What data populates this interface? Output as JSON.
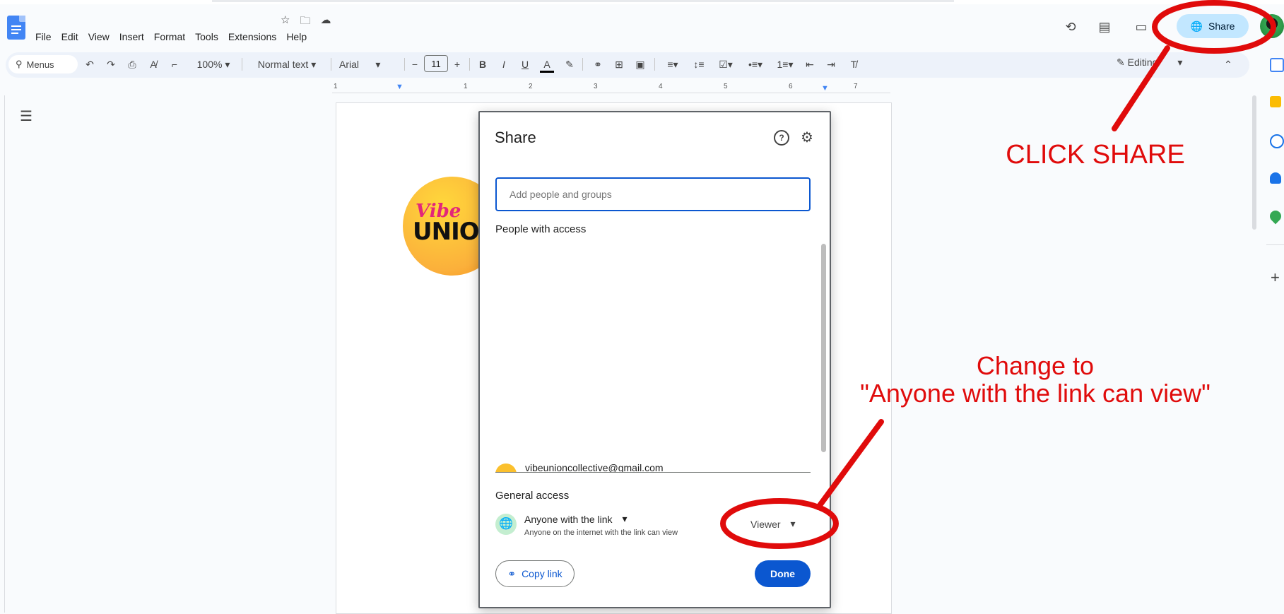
{
  "menu": {
    "items": [
      "File",
      "Edit",
      "View",
      "Insert",
      "Format",
      "Tools",
      "Extensions",
      "Help"
    ]
  },
  "header": {
    "share_label": "Share"
  },
  "toolbar": {
    "search_label": "Menus",
    "zoom": "100%",
    "style": "Normal text",
    "font": "Arial",
    "font_size": "11",
    "bold": "B",
    "italic": "I",
    "underline": "U",
    "text_color": "A",
    "editing_label": "Editing"
  },
  "ruler": {
    "labels": [
      "1",
      "1",
      "2",
      "3",
      "4",
      "5",
      "6",
      "7"
    ]
  },
  "document": {
    "logo_top": "Vibe",
    "logo_bottom": "UNIO"
  },
  "dialog": {
    "title": "Share",
    "help_icon_glyph": "?",
    "search_placeholder": "Add people and groups",
    "people_heading": "People with access",
    "person_email": "vibeunioncollective@gmail.com",
    "general_access_heading": "General access",
    "access_type": "Anyone with the link",
    "access_description": "Anyone on the internet with the link can view",
    "role": "Viewer",
    "copy_link_label": "Copy link",
    "done_label": "Done"
  },
  "annotations": {
    "click_share": "CLICK SHARE",
    "change_line1": "Change to",
    "change_line2": "\"Anyone with the link can view\""
  },
  "colors": {
    "accent_blue": "#0b57d0",
    "share_button_bg": "#c2e7ff",
    "annotation_red": "#e00b0b"
  },
  "icons": {
    "header": [
      "history-icon",
      "comment-icon",
      "meet-icon"
    ],
    "side_panel": [
      "calendar-icon",
      "keep-icon",
      "tasks-icon",
      "contacts-icon",
      "maps-icon",
      "add-icon"
    ]
  }
}
